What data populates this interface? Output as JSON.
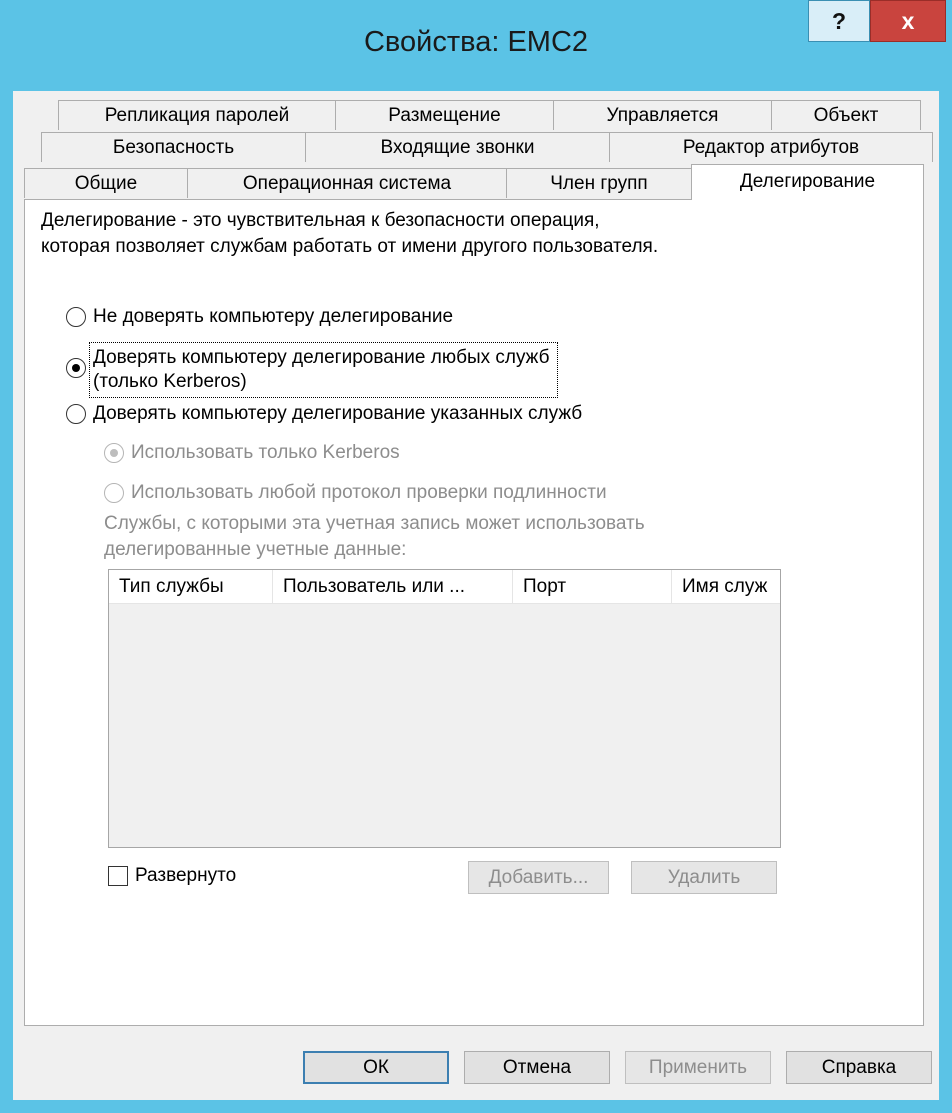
{
  "window": {
    "title": "Свойства: EMC2",
    "help_label": "?",
    "close_label": "x"
  },
  "tabs": {
    "row1": [
      "Репликация паролей",
      "Размещение",
      "Управляется",
      "Объект"
    ],
    "row2": [
      "Безопасность",
      "Входящие звонки",
      "Редактор атрибутов"
    ],
    "row3": [
      "Общие",
      "Операционная система",
      "Член групп",
      "Делегирование"
    ],
    "active": "Делегирование"
  },
  "delegation": {
    "desc_line1": "Делегирование - это чувствительная к безопасности операция,",
    "desc_line2": "которая позволяет службам работать от имени другого пользователя.",
    "opt_no_trust": "Не доверять компьютеру делегирование",
    "opt_trust_any_line1": "Доверять компьютеру делегирование любых служб",
    "opt_trust_any_line2": "(только Kerberos)",
    "opt_trust_specified": "Доверять компьютеру делегирование указанных служб",
    "sub_kerberos_only": "Использовать только Kerberos",
    "sub_any_protocol": "Использовать любой протокол проверки подлинности",
    "services_label_line1": "Службы, с которыми эта учетная запись может использовать",
    "services_label_line2": "делегированные учетные данные:",
    "selected_option": "trust_any",
    "sub_selected": "kerberos_only"
  },
  "services_table": {
    "columns": [
      "Тип службы",
      "Пользователь или ...",
      "Порт",
      "Имя служ"
    ],
    "rows": []
  },
  "expanded_label": "Развернуто",
  "add_button": "Добавить...",
  "remove_button": "Удалить",
  "footer": {
    "ok": "ОК",
    "cancel": "Отмена",
    "apply": "Применить",
    "help": "Справка"
  },
  "colors": {
    "titlebar": "#5bc3e6",
    "close_button": "#c9443e",
    "dialog_bg": "#f0f0f0"
  }
}
